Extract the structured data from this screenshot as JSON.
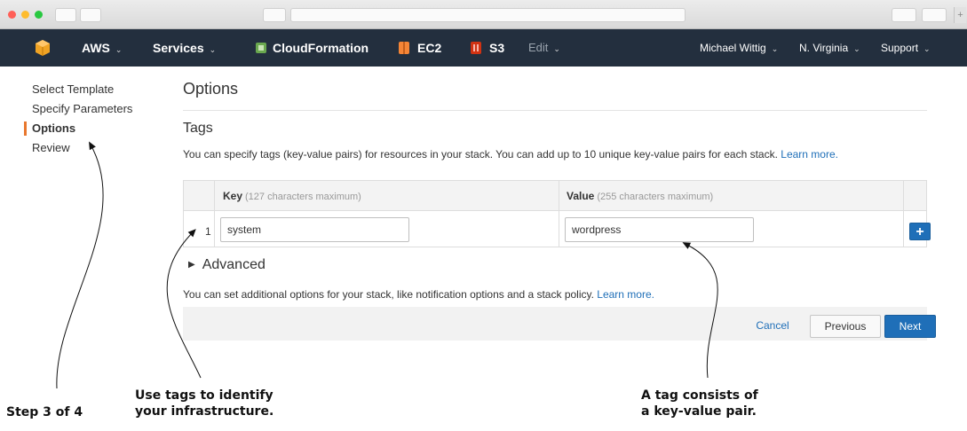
{
  "nav": {
    "aws_label": "AWS",
    "services_label": "Services",
    "cloudformation_label": "CloudFormation",
    "ec2_label": "EC2",
    "s3_label": "S3",
    "edit_label": "Edit",
    "user_label": "Michael Wittig",
    "region_label": "N. Virginia",
    "support_label": "Support",
    "caret": "⌄"
  },
  "sidebar": {
    "items": [
      {
        "label": "Select Template"
      },
      {
        "label": "Specify Parameters"
      },
      {
        "label": "Options"
      },
      {
        "label": "Review"
      }
    ]
  },
  "main": {
    "title": "Options",
    "tags_heading": "Tags",
    "tags_desc": "You can specify tags (key-value pairs) for resources in your stack. You can add up to 10 unique key-value pairs for each stack.",
    "learn_more": "Learn more.",
    "table": {
      "key_header": "Key",
      "key_hint": "(127 characters maximum)",
      "value_header": "Value",
      "value_hint": "(255 characters maximum)",
      "rows": [
        {
          "num": "1",
          "key": "system",
          "value": "wordpress"
        }
      ],
      "add_label": "+"
    },
    "advanced_label": "Advanced",
    "advanced_desc": "You can set additional options for your stack, like notification options and a stack policy."
  },
  "footer": {
    "cancel": "Cancel",
    "previous": "Previous",
    "next": "Next"
  },
  "annotations": {
    "step": "Step 3 of 4",
    "tags_line1": "Use tags to identify",
    "tags_line2": "your infrastructure.",
    "pair_line1": "A tag consists of",
    "pair_line2": "a key-value pair."
  },
  "colors": {
    "aws_nav_bg": "#232f3e",
    "link_blue": "#1f6fb8",
    "active_marker": "#e8772e",
    "aws_orange": "#f0a324",
    "s3_red": "#d13212"
  }
}
